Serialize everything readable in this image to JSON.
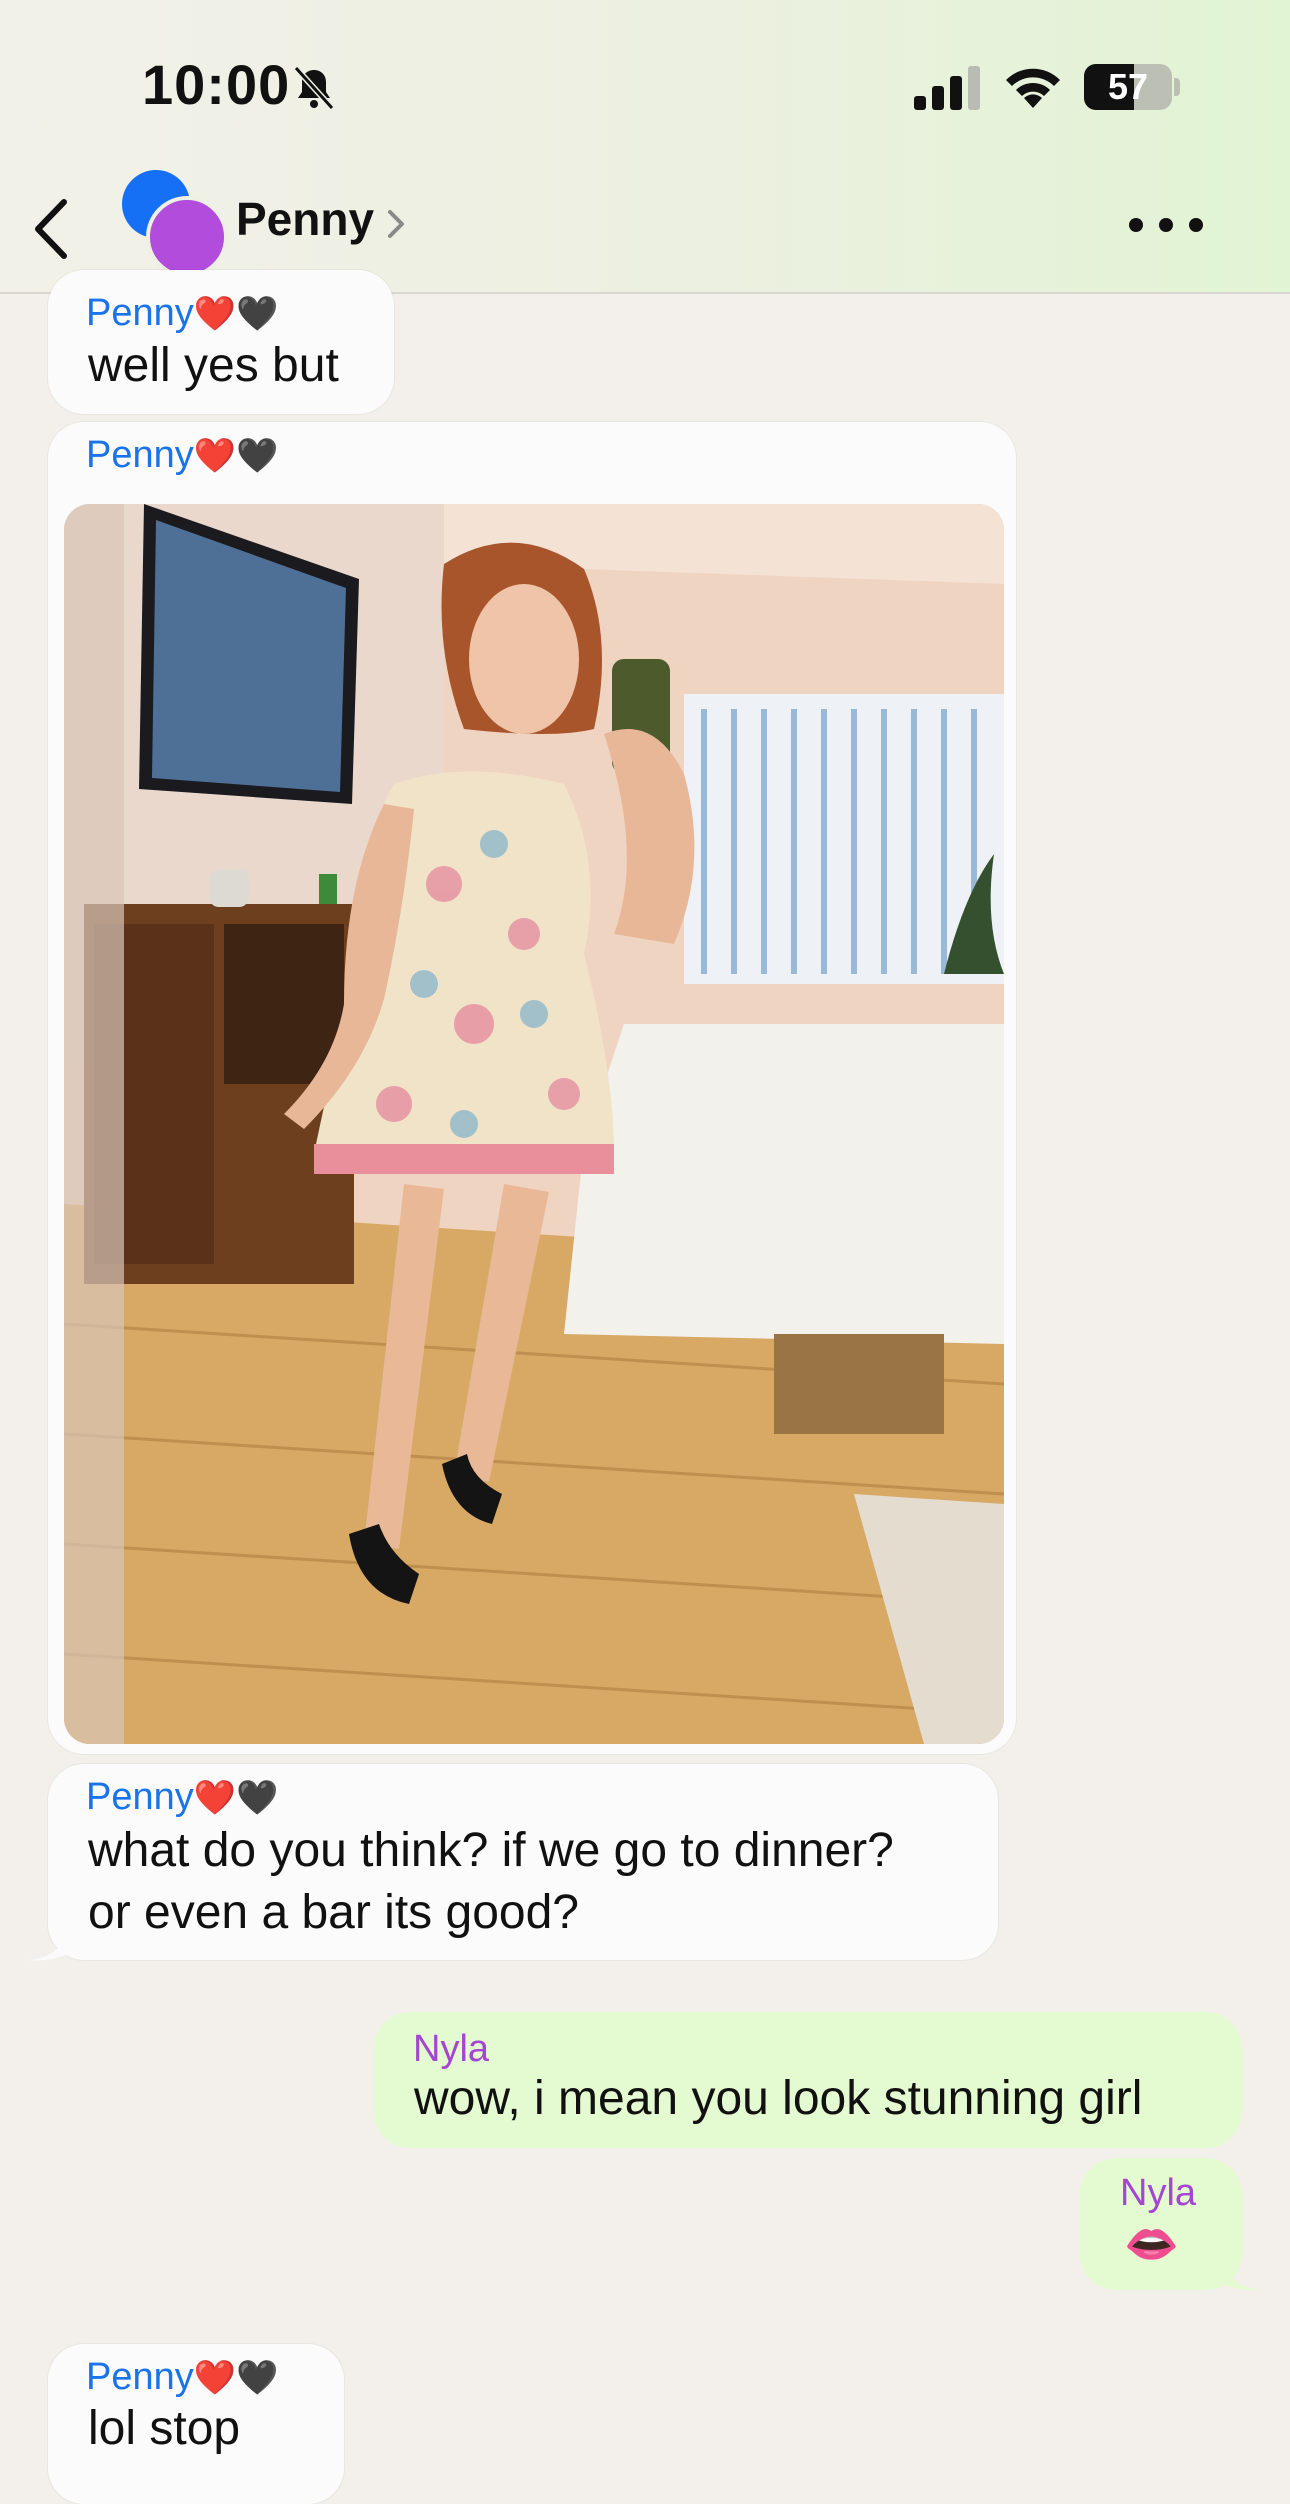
{
  "status_bar": {
    "time": "10:00",
    "battery": "57",
    "battery_level": 0.57,
    "icons": [
      "bell-slash-icon",
      "signal-icon",
      "wifi-icon",
      "battery-icon"
    ]
  },
  "header": {
    "contact_name": "Penny",
    "icons": [
      "back-chevron-icon",
      "chevron-right-icon",
      "more-icon"
    ],
    "avatar_colors": [
      "#1570f5",
      "#b14cdc"
    ]
  },
  "messages": [
    {
      "sender": "Penny",
      "hearts": "❤️🖤",
      "text": "well yes but",
      "direction": "incoming"
    },
    {
      "sender": "Penny",
      "hearts": "❤️🖤",
      "type": "image",
      "direction": "incoming"
    },
    {
      "sender": "Penny",
      "hearts": "❤️🖤",
      "lines": [
        "what do you think? if we go to dinner?",
        "or even a bar its good?"
      ],
      "direction": "incoming"
    },
    {
      "sender": "Nyla",
      "text": "wow, i mean you look stunning girl",
      "direction": "outgoing"
    },
    {
      "sender": "Nyla",
      "emoji": "👄",
      "direction": "outgoing"
    },
    {
      "sender": "Penny",
      "hearts": "❤️🖤",
      "text": "lol stop",
      "direction": "incoming"
    }
  ],
  "colors": {
    "incoming_name": "#1a73e8",
    "outgoing_name": "#a446d2",
    "outgoing_bubble": "#e4fbd2",
    "incoming_bubble": "#fbfbfb"
  }
}
